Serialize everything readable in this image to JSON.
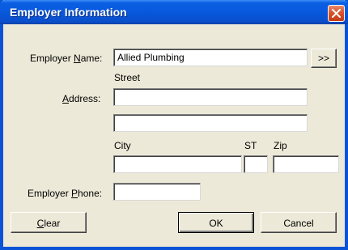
{
  "window": {
    "title": "Employer Information"
  },
  "form": {
    "employer_name": {
      "label_prefix": "Employer ",
      "label_accel": "N",
      "label_suffix": "ame:",
      "value": "Allied Plumbing",
      "lookup_button": ">>"
    },
    "address": {
      "street_label": "Street",
      "label_accel": "A",
      "label_suffix": "ddress:",
      "line1": "",
      "line2": ""
    },
    "city": {
      "label": "City",
      "value": ""
    },
    "state": {
      "label": "ST",
      "value": ""
    },
    "zip": {
      "label": "Zip",
      "value": ""
    },
    "employer_phone": {
      "label_prefix": "Employer ",
      "label_accel": "P",
      "label_suffix": "hone:",
      "value": ""
    }
  },
  "buttons": {
    "clear_accel": "C",
    "clear_suffix": "lear",
    "ok": "OK",
    "cancel": "Cancel"
  },
  "icons": {
    "close": "close-icon"
  }
}
